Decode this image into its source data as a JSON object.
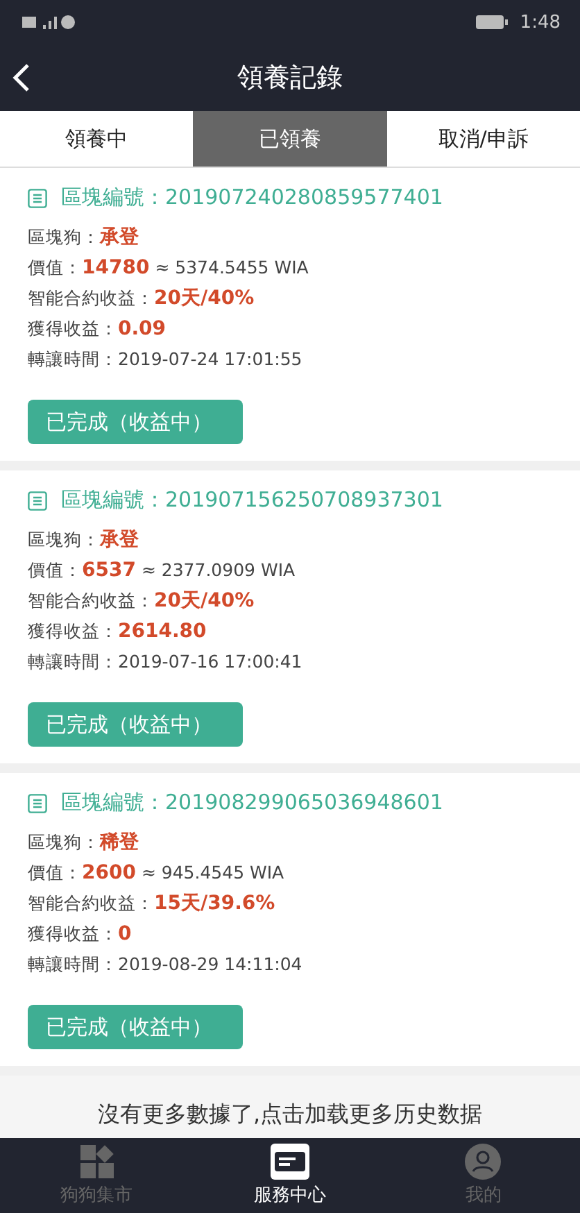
{
  "status_bar": {
    "time": "1:48"
  },
  "header": {
    "title": "領養記錄"
  },
  "tabs": [
    {
      "label": "領養中",
      "selected": false
    },
    {
      "label": "已領養",
      "selected": true
    },
    {
      "label": "取消/申訴",
      "selected": false
    }
  ],
  "records": [
    {
      "id_label": "區塊編號：",
      "id": "201907240280859577401",
      "dog_label": "區塊狗：",
      "dog": "承登",
      "value_label": "價值：",
      "value": "14780",
      "value_conv": " ≈ 5374.5455 WIA",
      "contract_label": "智能合約收益：",
      "contract": "20天/40%",
      "earned_label": "獲得收益：",
      "earned": "0.09",
      "time_label": "轉讓時間：",
      "time": "2019-07-24 17:01:55",
      "status": "已完成（收益中）"
    },
    {
      "id_label": "區塊編號：",
      "id": "201907156250708937301",
      "dog_label": "區塊狗：",
      "dog": "承登",
      "value_label": "價值：",
      "value": "6537",
      "value_conv": " ≈ 2377.0909 WIA",
      "contract_label": "智能合約收益：",
      "contract": "20天/40%",
      "earned_label": "獲得收益：",
      "earned": "2614.80",
      "time_label": "轉讓時間：",
      "time": "2019-07-16 17:00:41",
      "status": "已完成（收益中）"
    },
    {
      "id_label": "區塊編號：",
      "id": "201908299065036948601",
      "dog_label": "區塊狗：",
      "dog": "稀登",
      "value_label": "價值：",
      "value": "2600",
      "value_conv": " ≈ 945.4545 WIA",
      "contract_label": "智能合約收益：",
      "contract": "15天/39.6%",
      "earned_label": "獲得收益：",
      "earned": "0",
      "time_label": "轉讓時間：",
      "time": "2019-08-29 14:11:04",
      "status": "已完成（收益中）"
    }
  ],
  "footer_note": "沒有更多數據了,点击加载更多历史数据",
  "bottom_nav": [
    {
      "label": "狗狗集市",
      "kind": "market",
      "selected": false
    },
    {
      "label": "服務中心",
      "kind": "service",
      "selected": true
    },
    {
      "label": "我的",
      "kind": "profile",
      "selected": false
    }
  ]
}
